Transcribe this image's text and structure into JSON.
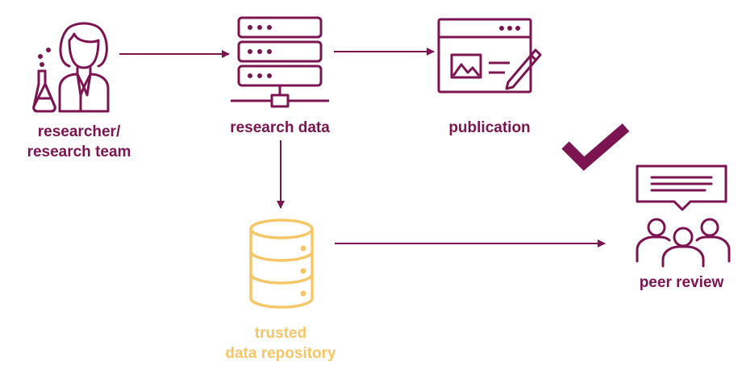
{
  "colors": {
    "primary": "#7b1450",
    "repository": "#f6c667"
  },
  "nodes": {
    "researcher": {
      "label_line1": "researcher/",
      "label_line2": "research team",
      "icon": "scientist-icon"
    },
    "research_data": {
      "label": "research data",
      "icon": "server-icon"
    },
    "publication": {
      "label": "publication",
      "icon": "publication-icon"
    },
    "repository": {
      "label_line1": "trusted",
      "label_line2": "data repository",
      "icon": "database-icon"
    },
    "peer_review": {
      "label": "peer review",
      "icon": "peer-review-icon"
    }
  },
  "status": {
    "icon": "checkmark-icon"
  }
}
